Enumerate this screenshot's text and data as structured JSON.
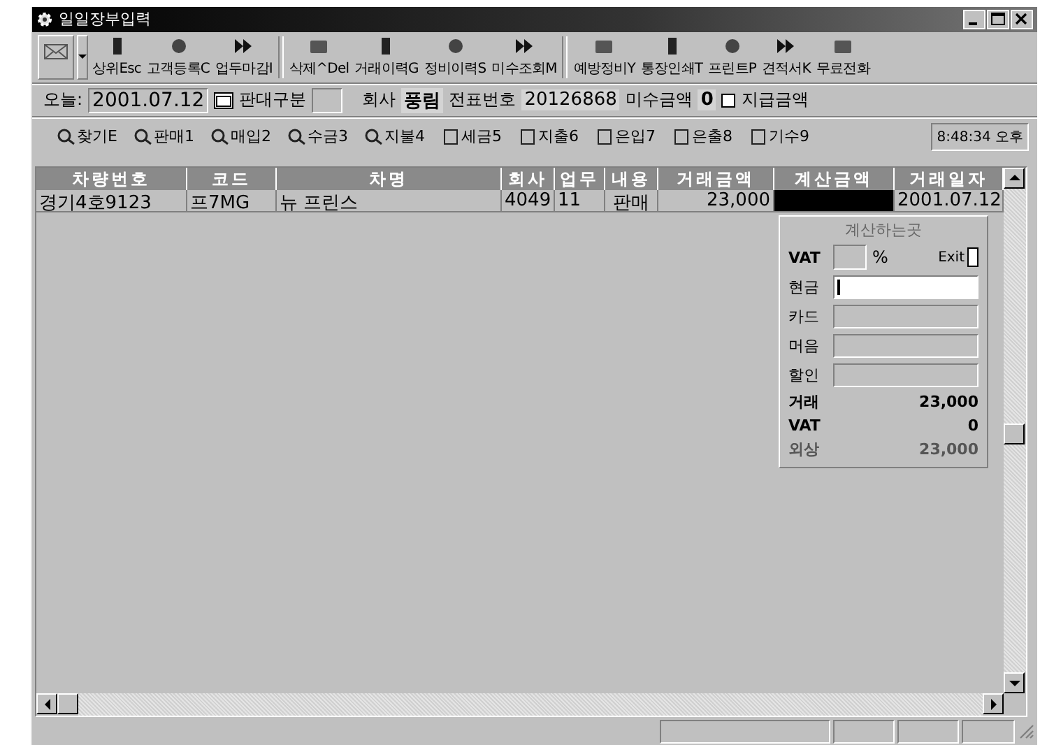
{
  "window": {
    "title": "일일장부입력"
  },
  "toolbar": [
    {
      "label": "상위Esc"
    },
    {
      "label": "고객등록C"
    },
    {
      "label": "업두마감I"
    },
    {
      "label": "삭제^Del"
    },
    {
      "label": "거래이력G"
    },
    {
      "label": "정비이력S"
    },
    {
      "label": "미수조회M"
    },
    {
      "label": "예방정비Y"
    },
    {
      "label": "통장인쇄T"
    },
    {
      "label": "프린트P"
    },
    {
      "label": "견적서K"
    },
    {
      "label": "무료전화"
    }
  ],
  "info": {
    "today_label": "오늘:",
    "today": "2001.07.12",
    "type_label": "판대구분",
    "company_label": "회사",
    "company": "풍림",
    "slip_label": "전표번호",
    "slip": "20126868",
    "unpaid_label": "미수금액",
    "unpaid": "0",
    "pay_checked": false,
    "pay_label": "지급금액"
  },
  "actions": [
    {
      "label": "찾기E"
    },
    {
      "label": "판매1"
    },
    {
      "label": "매입2"
    },
    {
      "label": "수금3"
    },
    {
      "label": "지불4"
    },
    {
      "label": "세금5"
    },
    {
      "label": "지출6"
    },
    {
      "label": "은입7"
    },
    {
      "label": "은출8"
    },
    {
      "label": "기수9"
    }
  ],
  "clock": "8:48:34 오후",
  "table": {
    "columns": [
      "차량번호",
      "코드",
      "차명",
      "회사",
      "업무",
      "내용",
      "거래금액",
      "계산금액",
      "거래일자"
    ],
    "rows": [
      {
        "cells": [
          {
            "text": "경기4호9123",
            "selected": false
          },
          {
            "text": "프7MG",
            "selected": false
          },
          {
            "text": "뉴 프린스",
            "selected": false
          },
          {
            "text": "4049",
            "selected": false
          },
          {
            "text": "11",
            "selected": false
          },
          {
            "text": "판매",
            "selected": false
          },
          {
            "text": "23,000",
            "selected": false
          },
          {
            "selected": true
          },
          {
            "text": "2001.07.12",
            "selected": false
          }
        ]
      }
    ]
  },
  "calculator": {
    "title": "계산하는곳",
    "vat_label": "VAT",
    "percent": "%",
    "exit": "Exit",
    "fields": [
      {
        "label": "현금",
        "focused": true
      },
      {
        "label": "카드",
        "focused": false
      },
      {
        "label": "머음",
        "focused": false
      },
      {
        "label": "할인",
        "focused": false
      }
    ],
    "totals": [
      {
        "label": "거래",
        "value": "23,000",
        "dimmed": false
      },
      {
        "label": "VAT",
        "value": "0",
        "dimmed": false
      },
      {
        "label": "외상",
        "value": "23,000",
        "dimmed": true
      }
    ]
  }
}
